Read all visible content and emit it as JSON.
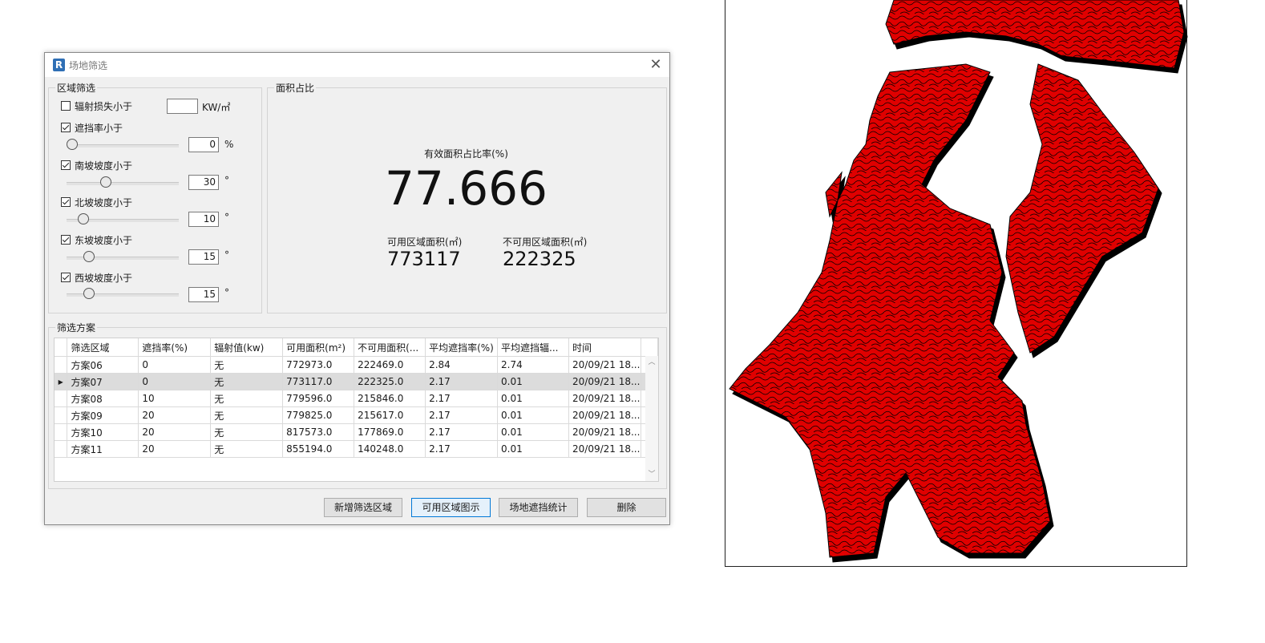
{
  "window": {
    "title": "场地筛选",
    "icon_letter": "R",
    "close_glyph": "✕"
  },
  "filter_group": {
    "legend": "区域筛选",
    "radiation": {
      "label": "辐射损失小于",
      "checked": false,
      "value": "",
      "unit": "KW/㎡"
    },
    "shading": {
      "label": "遮挡率小于",
      "checked": true,
      "value": "0",
      "unit": "%",
      "slider_fraction": 0.0
    },
    "south_slope": {
      "label": "南坡坡度小于",
      "checked": true,
      "value": "30",
      "unit": "°",
      "slider_fraction": 0.33
    },
    "north_slope": {
      "label": "北坡坡度小于",
      "checked": true,
      "value": "10",
      "unit": "°",
      "slider_fraction": 0.11
    },
    "east_slope": {
      "label": "东坡坡度小于",
      "checked": true,
      "value": "15",
      "unit": "°",
      "slider_fraction": 0.17
    },
    "west_slope": {
      "label": "西坡坡度小于",
      "checked": true,
      "value": "15",
      "unit": "°",
      "slider_fraction": 0.17
    }
  },
  "area_group": {
    "legend": "面积占比",
    "ratio_caption": "有效面积占比率(%)",
    "ratio_value": "77.666",
    "usable_caption": "可用区域面积(㎡)",
    "usable_value": "773117",
    "unusable_caption": "不可用区域面积(㎡)",
    "unusable_value": "222325"
  },
  "plan_group": {
    "legend": "筛选方案",
    "columns": [
      "筛选区域",
      "遮挡率(%)",
      "辐射值(kw)",
      "可用面积(m²)",
      "不可用面积(...",
      "平均遮挡率(%)",
      "平均遮挡辐...",
      "时间"
    ],
    "selected_row_marker": "▶",
    "rows": [
      [
        "方案06",
        "0",
        "无",
        "772973.0",
        "222469.0",
        "2.84",
        "2.74",
        "20/09/21 18..."
      ],
      [
        "方案07",
        "0",
        "无",
        "773117.0",
        "222325.0",
        "2.17",
        "0.01",
        "20/09/21 18..."
      ],
      [
        "方案08",
        "10",
        "无",
        "779596.0",
        "215846.0",
        "2.17",
        "0.01",
        "20/09/21 18..."
      ],
      [
        "方案09",
        "20",
        "无",
        "779825.0",
        "215617.0",
        "2.17",
        "0.01",
        "20/09/21 18..."
      ],
      [
        "方案10",
        "20",
        "无",
        "817573.0",
        "177869.0",
        "2.17",
        "0.01",
        "20/09/21 18..."
      ],
      [
        "方案11",
        "20",
        "无",
        "855194.0",
        "140248.0",
        "2.17",
        "0.01",
        "20/09/21 18..."
      ]
    ],
    "selected_index": 1
  },
  "buttons": {
    "add_area": "新增筛选区域",
    "show_usable": "可用区域图示",
    "shading_stats": "场地遮挡统计",
    "delete": "删除"
  },
  "colors": {
    "terrain": "#e00000",
    "contour": "#000000"
  },
  "icons": {
    "close": "close-icon",
    "app": "revit-logo-icon",
    "scroll_up": "chevron-up-icon",
    "scroll_down": "chevron-down-icon"
  }
}
